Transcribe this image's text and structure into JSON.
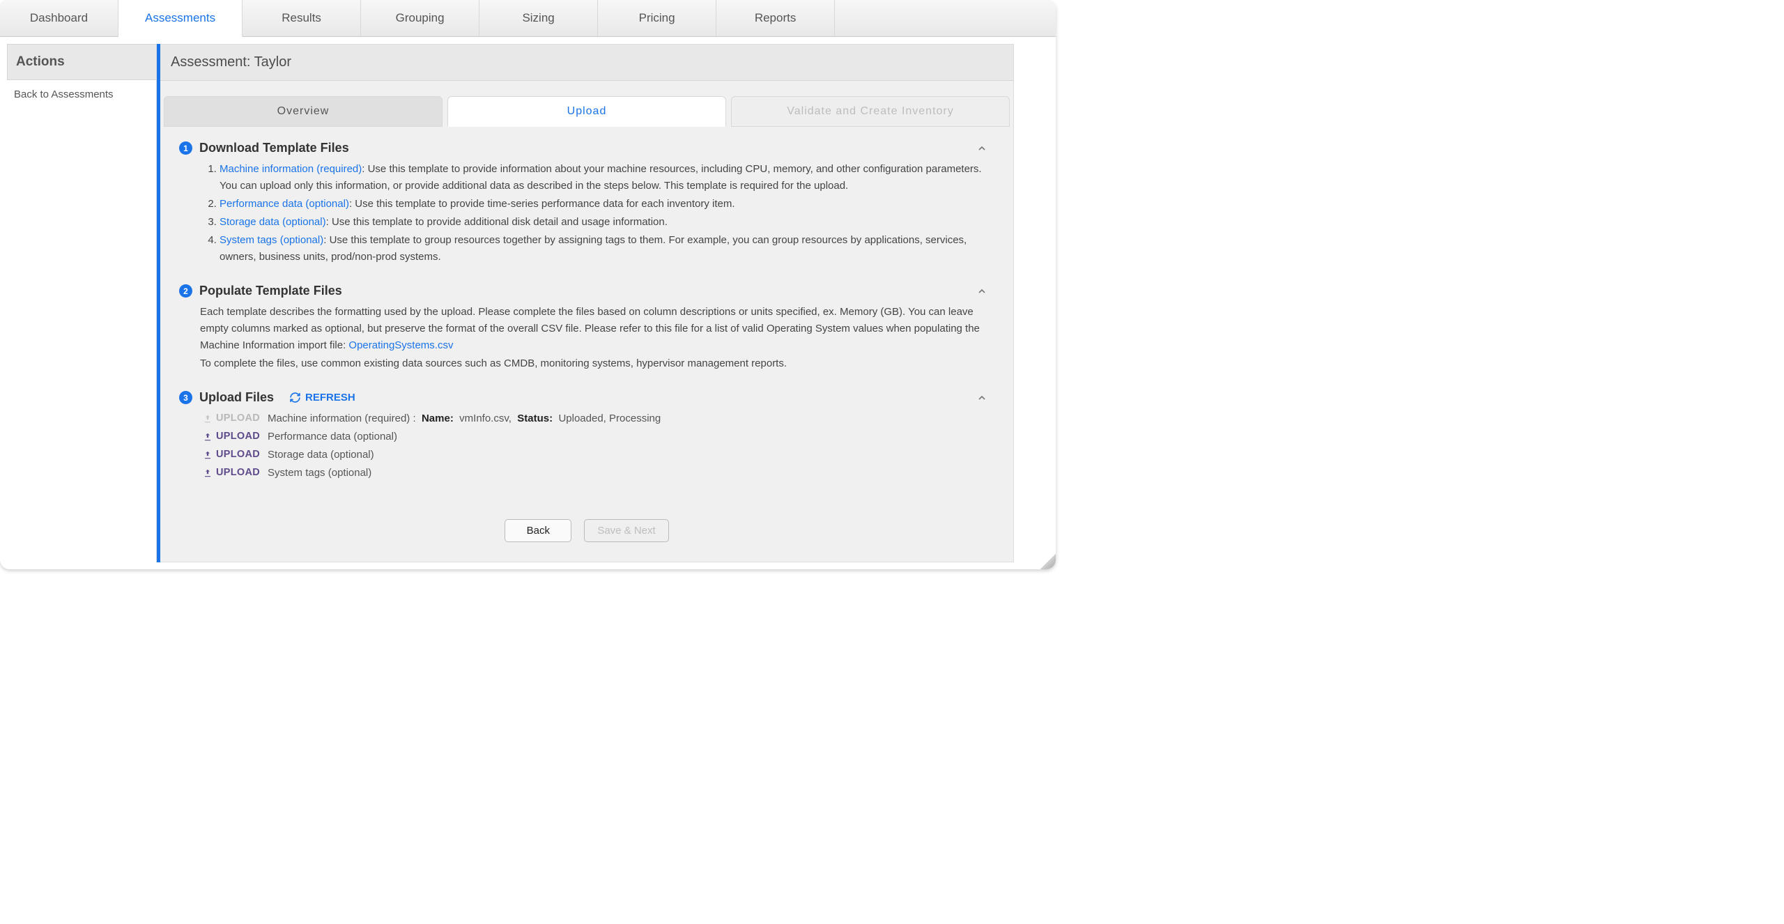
{
  "topnav": {
    "tabs": [
      {
        "label": "Dashboard"
      },
      {
        "label": "Assessments"
      },
      {
        "label": "Results"
      },
      {
        "label": "Grouping"
      },
      {
        "label": "Sizing"
      },
      {
        "label": "Pricing"
      },
      {
        "label": "Reports"
      }
    ],
    "active_index": 1
  },
  "sidebar": {
    "header": "Actions",
    "back_link": "Back to Assessments"
  },
  "page_title": "Assessment: Taylor",
  "subtabs": {
    "overview": "Overview",
    "upload": "Upload",
    "validate": "Validate and Create Inventory"
  },
  "step1": {
    "title": "Download Template Files",
    "items": [
      {
        "link": "Machine information (required)",
        "text": ": Use this template to provide information about your machine resources, including CPU, memory, and other configuration parameters. You can upload only this information, or provide additional data as described in the steps below. This template is required for the upload."
      },
      {
        "link": "Performance data (optional)",
        "text": ": Use this template to provide time-series performance data for each inventory item."
      },
      {
        "link": "Storage data (optional)",
        "text": ": Use this template to provide additional disk detail and usage information."
      },
      {
        "link": "System tags (optional)",
        "text": ": Use this template to group resources together by assigning tags to them. For example, you can group resources by applications, services, owners, business units, prod/non-prod systems."
      }
    ]
  },
  "step2": {
    "title": "Populate Template Files",
    "p1a": "Each template describes the formatting used by the upload. Please complete the files based on column descriptions or units specified, ex. Memory (GB). You can leave empty columns marked as optional, but preserve the format of the overall CSV file. Please refer to this file for a list of valid Operating System values when populating the Machine Information import file: ",
    "os_link": "OperatingSystems.csv",
    "p2": "To complete the files, use common existing data sources such as CMDB, monitoring systems, hypervisor management reports."
  },
  "step3": {
    "title": "Upload Files",
    "refresh": "REFRESH",
    "upload_label": "UPLOAD",
    "rows": [
      {
        "enabled": false,
        "desc": "Machine information (required) :",
        "name_label": "Name:",
        "name_val": "vmInfo.csv,",
        "status_label": "Status:",
        "status_val": "Uploaded, Processing"
      },
      {
        "enabled": true,
        "desc": "Performance data (optional)"
      },
      {
        "enabled": true,
        "desc": "Storage data (optional)"
      },
      {
        "enabled": true,
        "desc": "System tags (optional)"
      }
    ]
  },
  "footer": {
    "back": "Back",
    "save_next": "Save & Next"
  }
}
